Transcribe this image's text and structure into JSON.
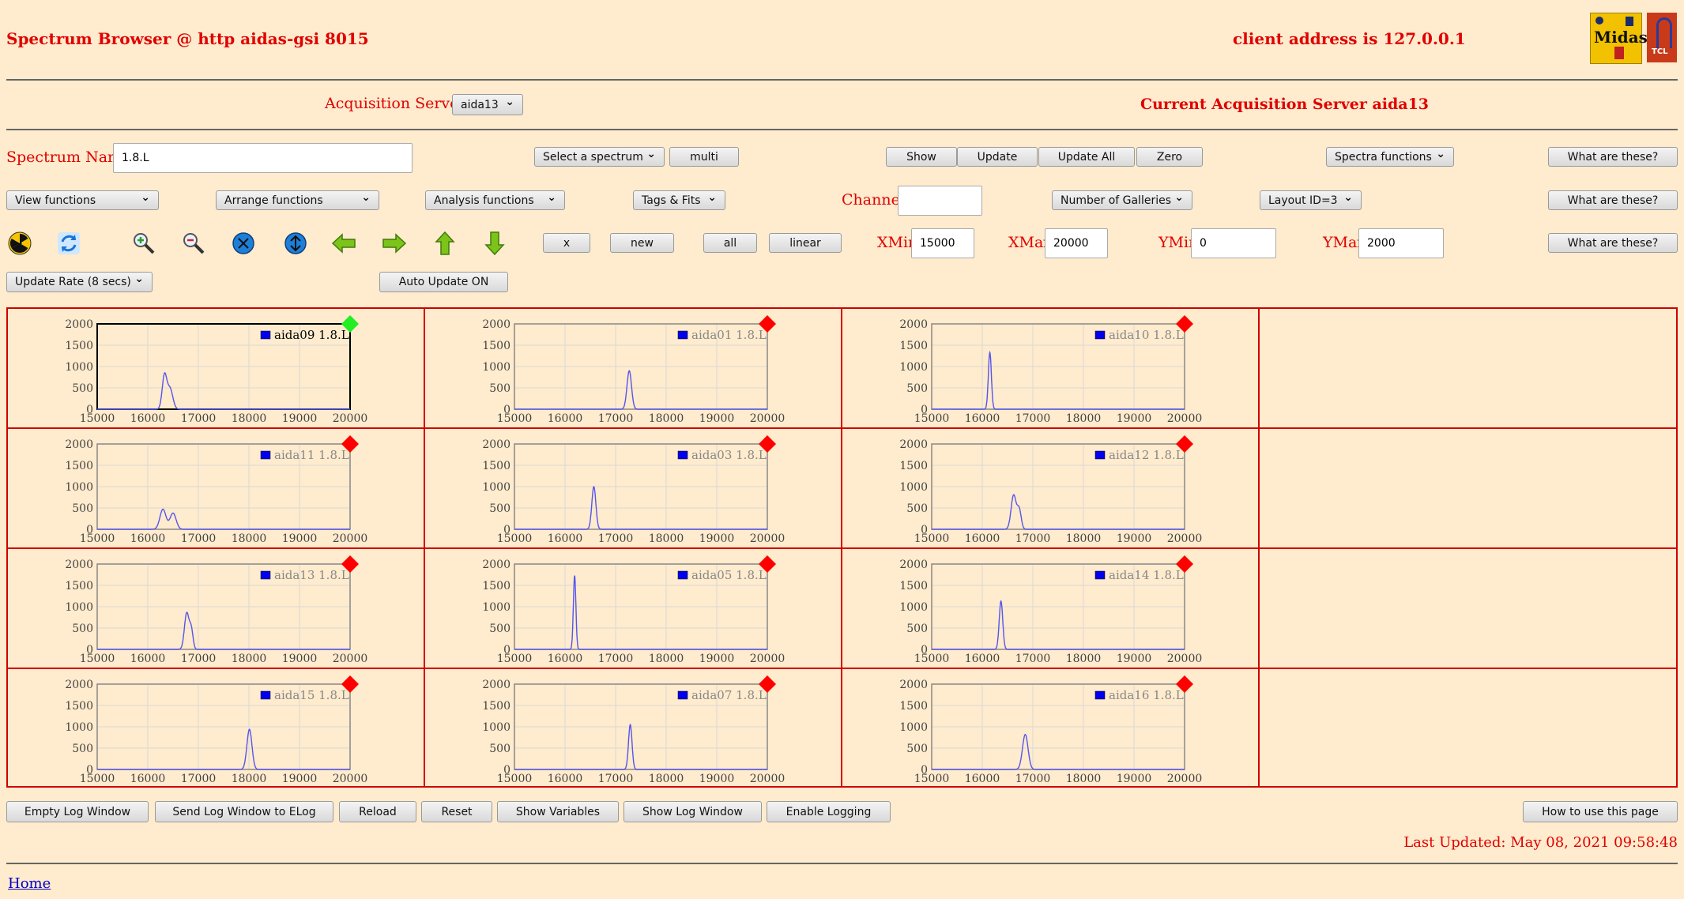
{
  "header": {
    "title": "Spectrum Browser @ http aidas-gsi 8015",
    "client_address": "client address is 127.0.0.1",
    "logo1_text": "Midas",
    "logo2_text": "TCL"
  },
  "acquisition": {
    "label": "Acquisition Servers",
    "server_select": "aida13",
    "current_label": "Current Acquisition Server aida13"
  },
  "row1": {
    "spectrum_name_label": "Spectrum Name:",
    "spectrum_name_value": "1.8.L",
    "select_spectrum": "Select a spectrum",
    "multi": "multi",
    "show": "Show",
    "update": "Update",
    "update_all": "Update All",
    "zero": "Zero",
    "spectra_functions": "Spectra functions",
    "what": "What are these?"
  },
  "row2": {
    "view_functions": "View functions",
    "arrange_functions": "Arrange functions",
    "analysis_functions": "Analysis functions",
    "tags_fits": "Tags & Fits",
    "channel_label": "Channel:",
    "channel_value": "",
    "num_galleries": "Number of Galleries",
    "layout_id": "Layout ID=3",
    "what": "What are these?"
  },
  "row3": {
    "x": "x",
    "new": "new",
    "all": "all",
    "linear": "linear",
    "xmin_label": "XMin",
    "xmin_value": "15000",
    "xmax_label": "XMax",
    "xmax_value": "20000",
    "ymin_label": "YMin",
    "ymin_value": "0",
    "ymax_label": "YMax",
    "ymax_value": "2000",
    "what": "What are these?"
  },
  "row4": {
    "update_rate": "Update Rate (8 secs)",
    "auto_update": "Auto Update ON"
  },
  "icons": [
    "radiation-icon",
    "refresh-icon",
    "zoom-in-icon",
    "zoom-out-icon",
    "shrink-vertical-icon",
    "expand-vertical-icon",
    "arrow-left-icon",
    "arrow-right-icon",
    "arrow-up-icon",
    "arrow-down-icon"
  ],
  "colors": {
    "background": "#ffebcd",
    "accent_red": "#e00000",
    "status_ok": "#22ee22",
    "status_bad": "#ff0000",
    "trace": "#5555ee"
  },
  "chart_data": {
    "type": "line",
    "xlim": [
      15000,
      20000
    ],
    "ylim": [
      0,
      2000
    ],
    "xticks": [
      "15000",
      "16000",
      "17000",
      "18000",
      "19000",
      "20000"
    ],
    "yticks": [
      "0",
      "500",
      "1000",
      "1500",
      "2000"
    ],
    "grid": true,
    "legend": "top-right",
    "panels": [
      {
        "name": "aida09 1.8.L",
        "status": "ok",
        "selected": true,
        "peaks": [
          [
            16330,
            780,
            45
          ],
          [
            16440,
            480,
            55
          ]
        ]
      },
      {
        "name": "aida01 1.8.L",
        "status": "bad",
        "selected": false,
        "peaks": [
          [
            17270,
            900,
            45
          ]
        ]
      },
      {
        "name": "aida10 1.8.L",
        "status": "bad",
        "selected": false,
        "peaks": [
          [
            16150,
            1330,
            30
          ]
        ]
      },
      {
        "name": "aida11 1.8.L",
        "status": "bad",
        "selected": false,
        "peaks": [
          [
            16300,
            470,
            60
          ],
          [
            16500,
            380,
            60
          ]
        ]
      },
      {
        "name": "aida03 1.8.L",
        "status": "bad",
        "selected": false,
        "peaks": [
          [
            16570,
            1000,
            40
          ]
        ]
      },
      {
        "name": "aida12 1.8.L",
        "status": "bad",
        "selected": false,
        "peaks": [
          [
            16620,
            800,
            50
          ],
          [
            16730,
            450,
            40
          ]
        ]
      },
      {
        "name": "aida13 1.8.L",
        "status": "bad",
        "selected": false,
        "peaks": [
          [
            16770,
            850,
            45
          ],
          [
            16860,
            450,
            35
          ]
        ]
      },
      {
        "name": "aida05 1.8.L",
        "status": "bad",
        "selected": false,
        "peaks": [
          [
            16190,
            1730,
            25
          ]
        ]
      },
      {
        "name": "aida14 1.8.L",
        "status": "bad",
        "selected": false,
        "peaks": [
          [
            16370,
            1130,
            35
          ]
        ]
      },
      {
        "name": "aida15 1.8.L",
        "status": "bad",
        "selected": false,
        "peaks": [
          [
            18010,
            940,
            50
          ]
        ]
      },
      {
        "name": "aida07 1.8.L",
        "status": "bad",
        "selected": false,
        "peaks": [
          [
            17290,
            1050,
            35
          ]
        ]
      },
      {
        "name": "aida16 1.8.L",
        "status": "bad",
        "selected": false,
        "peaks": [
          [
            16850,
            820,
            55
          ]
        ]
      }
    ]
  },
  "footer": {
    "empty_log": "Empty Log Window",
    "send_log": "Send Log Window to ELog",
    "reload": "Reload",
    "reset": "Reset",
    "show_variables": "Show Variables",
    "show_log": "Show Log Window",
    "enable_logging": "Enable Logging",
    "how_to": "How to use this page",
    "last_updated": "Last Updated: May 08, 2021 09:58:48",
    "home": "Home"
  }
}
